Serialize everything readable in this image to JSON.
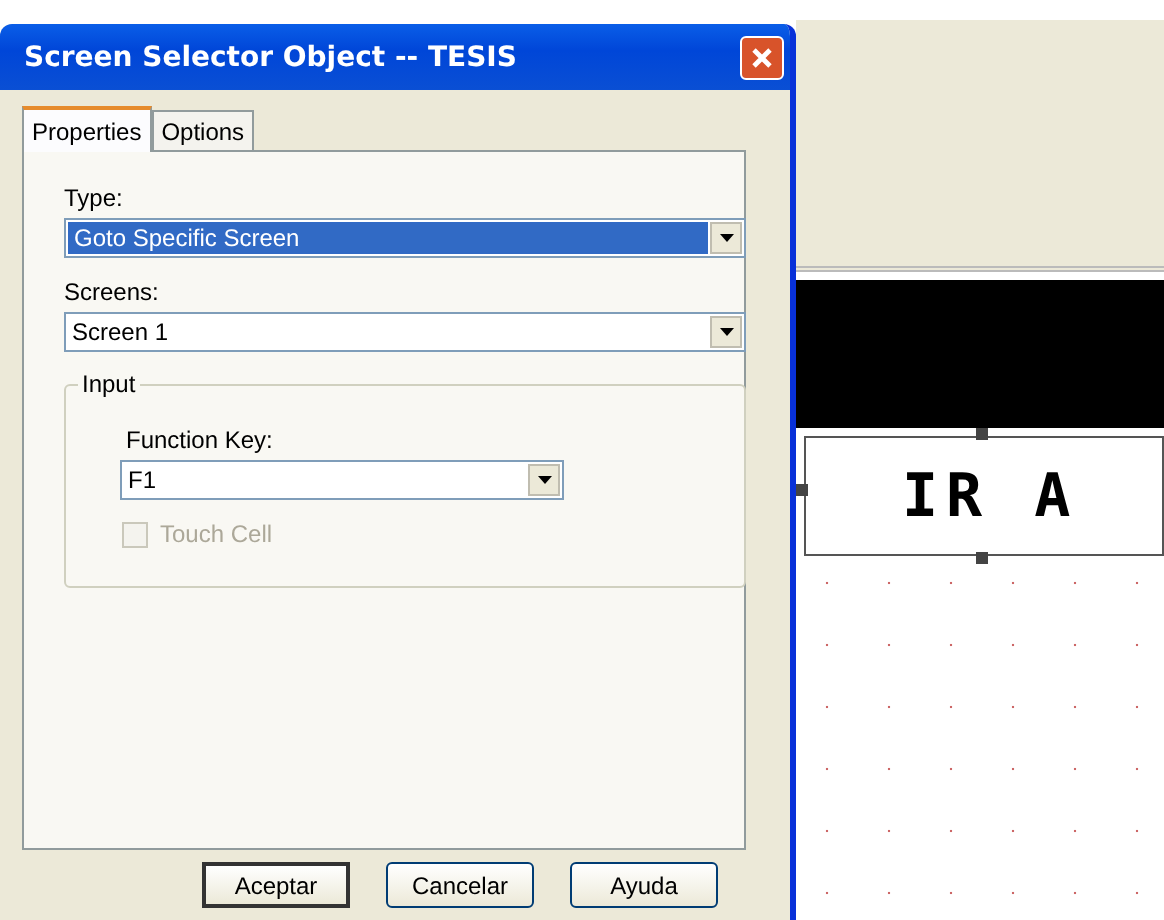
{
  "window": {
    "title": "Screen Selector Object -- TESIS"
  },
  "tabs": [
    {
      "label": "Properties",
      "selected": true
    },
    {
      "label": "Options",
      "selected": false
    }
  ],
  "type": {
    "label": "Type:",
    "value": "Goto Specific Screen",
    "highlighted": true
  },
  "screens": {
    "label": "Screens:",
    "value": "Screen 1",
    "highlighted": false
  },
  "input_group": {
    "title": "Input",
    "function_key": {
      "label": "Function Key:",
      "value": "F1"
    },
    "touch_cell": {
      "label": "Touch Cell",
      "checked": false,
      "disabled": true
    }
  },
  "buttons": [
    {
      "label": "Aceptar",
      "default": true
    },
    {
      "label": "Cancelar",
      "default": false
    },
    {
      "label": "Ayuda",
      "default": false
    }
  ],
  "canvas": {
    "object_text": "IR A"
  }
}
